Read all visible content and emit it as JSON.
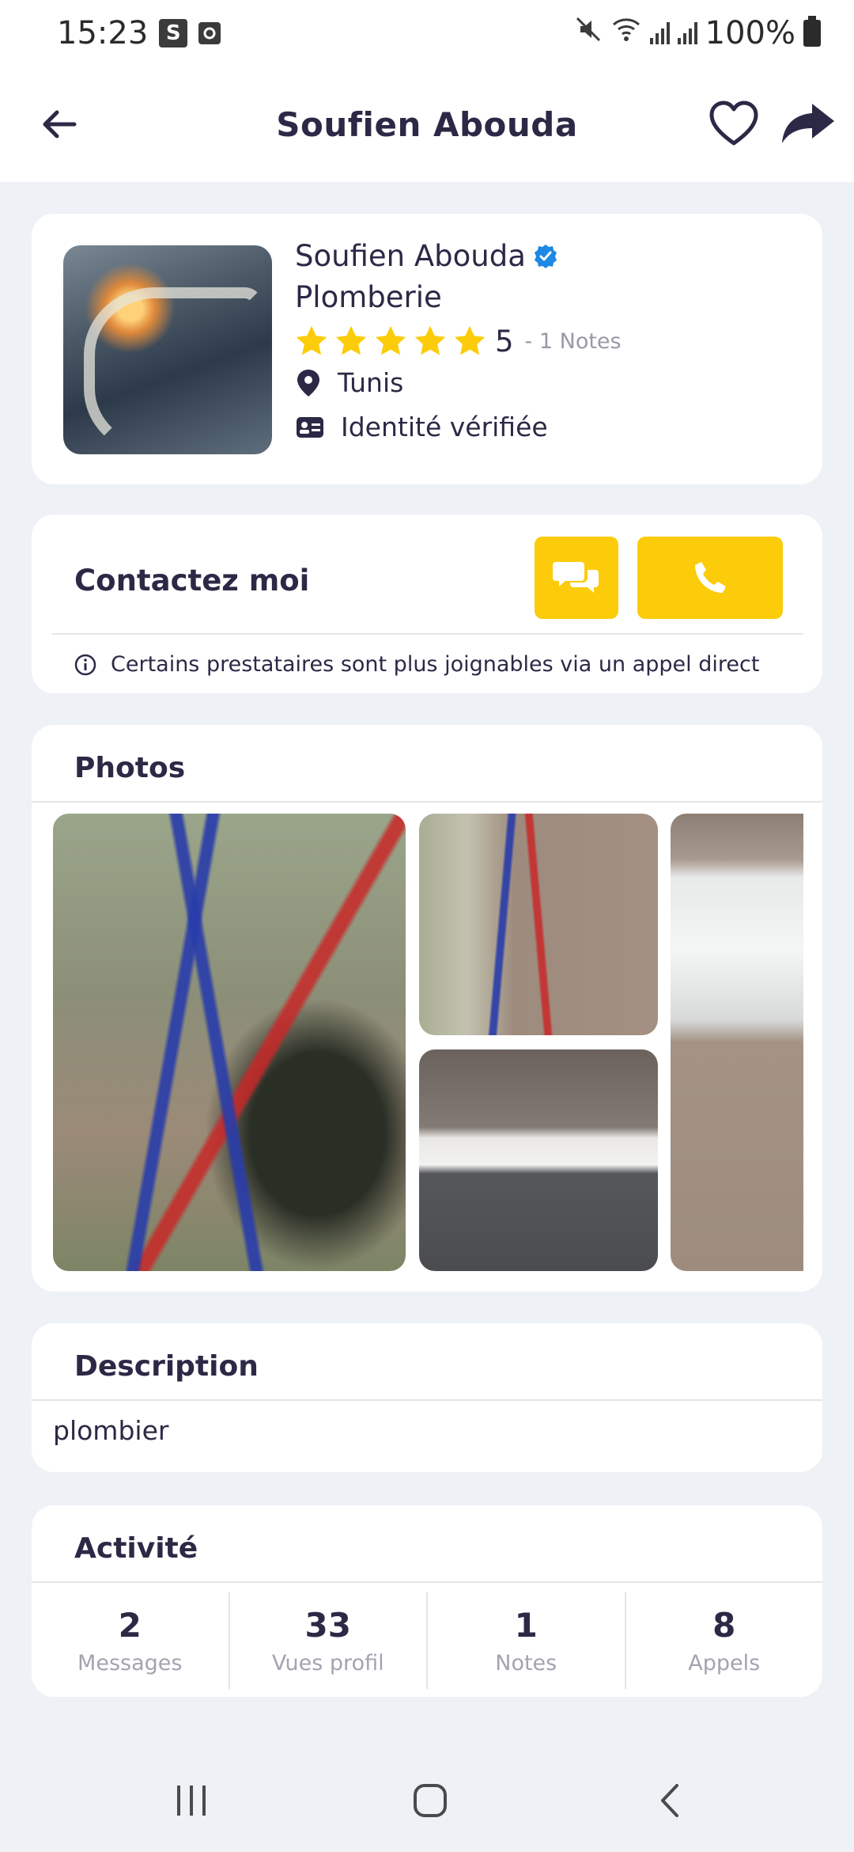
{
  "status_bar": {
    "time": "15:23",
    "icons": [
      "s-app-icon",
      "screen-record-icon",
      "mute-icon",
      "wifi-icon",
      "signal-icon",
      "signal-icon",
      "battery-icon"
    ],
    "battery": "100%"
  },
  "app_bar": {
    "title": "Soufien  Abouda"
  },
  "profile": {
    "name": "Soufien  Abouda",
    "category": "Plomberie",
    "rating_value": 5,
    "rating": "5",
    "notes": "- 1 Notes",
    "location": "Tunis",
    "identity": "Identité vérifiée"
  },
  "contact": {
    "title": "Contactez moi",
    "note": "Certains prestataires sont plus joignables via un appel direct"
  },
  "photos": {
    "title": "Photos"
  },
  "description": {
    "title": "Description",
    "text": "plombier"
  },
  "activity": {
    "title": "Activité",
    "stats": [
      {
        "value": "2",
        "label": "Messages"
      },
      {
        "value": "33",
        "label": "Vues profil"
      },
      {
        "value": "1",
        "label": "Notes"
      },
      {
        "value": "8",
        "label": "Appels"
      }
    ]
  },
  "colors": {
    "accent": "#fccc0a",
    "text": "#2c2946",
    "background": "#eef1f6",
    "verified": "#1e88e5"
  }
}
